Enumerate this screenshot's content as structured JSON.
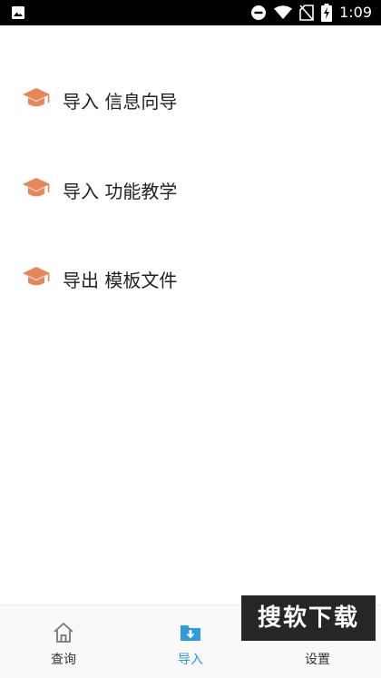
{
  "status_bar": {
    "time": "1:09",
    "icons": [
      "image-icon",
      "do-not-disturb-icon",
      "wifi-icon",
      "no-sim-icon",
      "battery-charging-icon"
    ]
  },
  "menu": {
    "items": [
      {
        "label": "导入 信息向导",
        "icon": "graduation-cap-icon"
      },
      {
        "label": "导入 功能教学",
        "icon": "graduation-cap-icon"
      },
      {
        "label": "导出 模板文件",
        "icon": "graduation-cap-icon"
      }
    ]
  },
  "tabbar": {
    "tabs": [
      {
        "label": "查询",
        "icon": "home-icon",
        "active": false
      },
      {
        "label": "导入",
        "icon": "folder-download-icon",
        "active": true
      },
      {
        "label": "设置",
        "icon": "settings-icon",
        "active": false
      }
    ]
  },
  "watermark": {
    "text": "搜软下载"
  },
  "colors": {
    "accent": "#2e9bdb",
    "cap": "#e8855a"
  }
}
